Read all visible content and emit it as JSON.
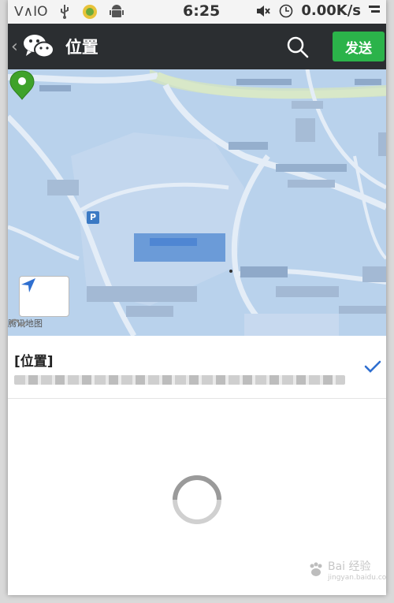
{
  "status_bar": {
    "time": "6:25",
    "net_speed": "0.00K/s",
    "icons": [
      "vaio-icon",
      "usb-icon",
      "wechat-notify-icon",
      "android-icon",
      "mute-icon",
      "clock-icon",
      "signal-icon"
    ]
  },
  "title_bar": {
    "title": "位置",
    "send_label": "发送"
  },
  "map": {
    "provider": "腾讯地图",
    "parking_label": "P",
    "water_color": "#b9d2ec"
  },
  "location": {
    "name": "[位置]"
  },
  "watermark": {
    "text": "Bai",
    "text2": "经验",
    "sub": "jingyan.baidu.com"
  },
  "colors": {
    "accent": "#2bb34a",
    "titlebar": "#2b2e31"
  }
}
